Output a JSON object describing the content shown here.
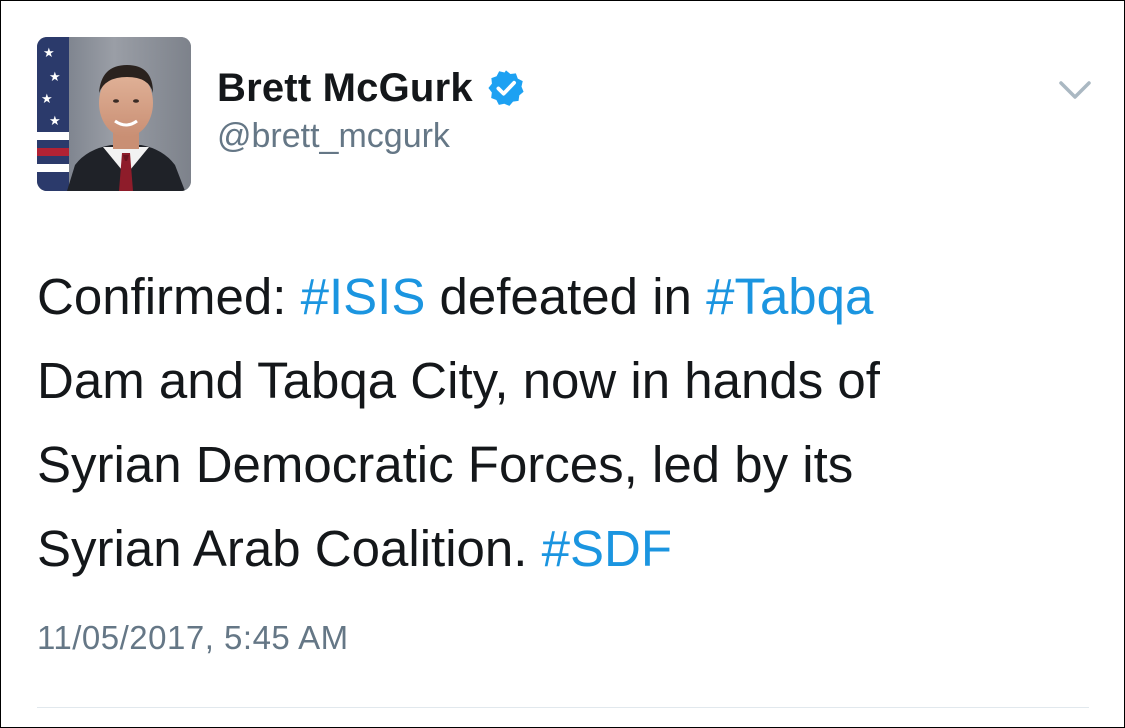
{
  "author": {
    "display_name": "Brett McGurk",
    "handle": "@brett_mcgurk",
    "verified": true
  },
  "tweet": {
    "lines": [
      [
        {
          "text": "Confirmed: ",
          "type": "text"
        },
        {
          "text": "#ISIS",
          "type": "hashtag"
        },
        {
          "text": " defeated in ",
          "type": "text"
        },
        {
          "text": "#Tabqa",
          "type": "hashtag"
        }
      ],
      [
        {
          "text": "Dam and Tabqa City, now in hands of",
          "type": "text"
        }
      ],
      [
        {
          "text": "Syrian Democratic Forces, led by its",
          "type": "text"
        }
      ],
      [
        {
          "text": "Syrian Arab Coalition. ",
          "type": "text"
        },
        {
          "text": "#SDF",
          "type": "hashtag"
        }
      ]
    ],
    "timestamp": "11/05/2017, 5:45 AM"
  },
  "icons": {
    "verified": "verified-badge-icon",
    "menu": "chevron-down-icon"
  },
  "colors": {
    "hashtag": "#1b95e0",
    "text": "#14171a",
    "secondary": "#657786",
    "verified_badge": "#1da1f2",
    "chevron": "#aab8c2"
  }
}
